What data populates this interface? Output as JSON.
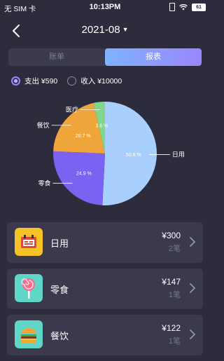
{
  "status_bar": {
    "carrier": "无 SIM 卡",
    "time": "10:13PM",
    "battery": "61"
  },
  "header": {
    "month": "2021-08"
  },
  "tabs": [
    {
      "label": "账单",
      "active": false
    },
    {
      "label": "报表",
      "active": true
    }
  ],
  "toggle": {
    "expense_label": "支出 ¥590",
    "income_label": "收入 ¥10000"
  },
  "chart_data": {
    "type": "pie",
    "slices": [
      {
        "label": "日用",
        "value": 50.8,
        "value_label": "50.8 %",
        "color": "#a9cfff"
      },
      {
        "label": "零食",
        "value": 24.9,
        "value_label": "24.9 %",
        "color": "#7b62f0"
      },
      {
        "label": "餐饮",
        "value": 20.7,
        "value_label": "20.7 %",
        "color": "#f0a53b"
      },
      {
        "label": "医疗",
        "value": 3.6,
        "value_label": "3.6 %",
        "color": "#82d68b"
      }
    ]
  },
  "categories": [
    {
      "name": "日用",
      "amount": "¥300",
      "count": "2笔",
      "icon": "daily-goods-icon",
      "icon_bg": "#f6c227"
    },
    {
      "name": "零食",
      "amount": "¥147",
      "count": "1笔",
      "icon": "lollipop-icon",
      "icon_bg": "#5fd6c8"
    },
    {
      "name": "餐饮",
      "amount": "¥122",
      "count": "1笔",
      "icon": "burger-icon",
      "icon_bg": "#5fd6c8"
    }
  ]
}
